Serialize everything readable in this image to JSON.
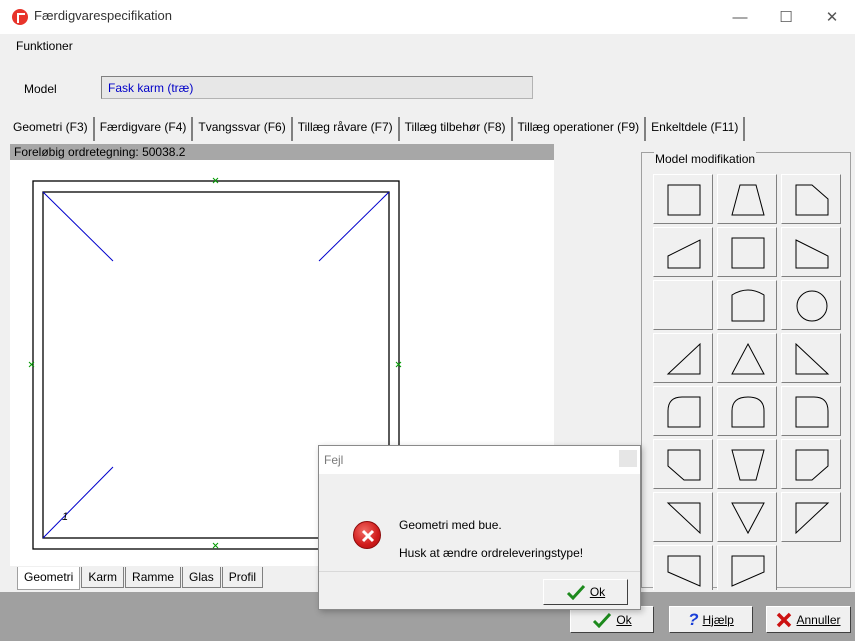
{
  "window": {
    "title": "Færdigvarespecifikation",
    "controls": {
      "minimize": "—",
      "maximize": "☐",
      "close": "✕"
    }
  },
  "menu": {
    "items": [
      "Funktioner"
    ]
  },
  "model": {
    "label": "Model",
    "value": "Fask karm (træ)"
  },
  "tabs": [
    "Geometri (F3)",
    "Færdigvare (F4)",
    "Tvangssvar (F6)",
    "Tillæg råvare (F7)",
    "Tillæg tilbehør (F8)",
    "Tillæg operationer (F9)",
    "Enkeltdele (F11)"
  ],
  "geometry": {
    "status_text": "Foreløbig ordretegning: 50038.2",
    "corner_label": "1"
  },
  "bottom_tabs": [
    "Geometri",
    "Karm",
    "Ramme",
    "Glas",
    "Profil"
  ],
  "model_modification": {
    "legend": "Model modifikation",
    "shapes": [
      "chamfer-top-left-icon",
      "trapezoid-icon",
      "chamfer-top-right-icon",
      "slope-left-icon",
      "rectangle-icon",
      "slope-right-icon",
      "blank-shape",
      "arch-top-icon",
      "circle-icon",
      "triangle-right-up-icon",
      "triangle-icon",
      "triangle-left-up-icon",
      "rounded-top-left-icon",
      "rounded-top-icon",
      "rounded-top-right-icon",
      "chamfer-bottom-left-icon",
      "inverted-trapezoid-icon",
      "chamfer-bottom-right-icon",
      "triangle-down-left-icon",
      "triangle-down-icon",
      "triangle-down-right-icon",
      "slope-bottom-left-icon",
      "slope-bottom-right-icon"
    ]
  },
  "footer": {
    "ok_label": "Ok",
    "help_label": "Hjælp",
    "cancel_label": "Annuller"
  },
  "dialog": {
    "title": "Fejl",
    "line1": "Geometri med bue.",
    "line2": "Husk at ændre ordreleveringstype!",
    "ok_label": "Ok"
  },
  "colors": {
    "model_value_text": "#0000c8",
    "drawing_lines": "#0000cc",
    "markers": "#009900",
    "error_icon": "#d01b1b",
    "check_icon": "#1d8a1d",
    "help_icon": "#1a3fd8",
    "cancel_icon": "#cc1111"
  }
}
